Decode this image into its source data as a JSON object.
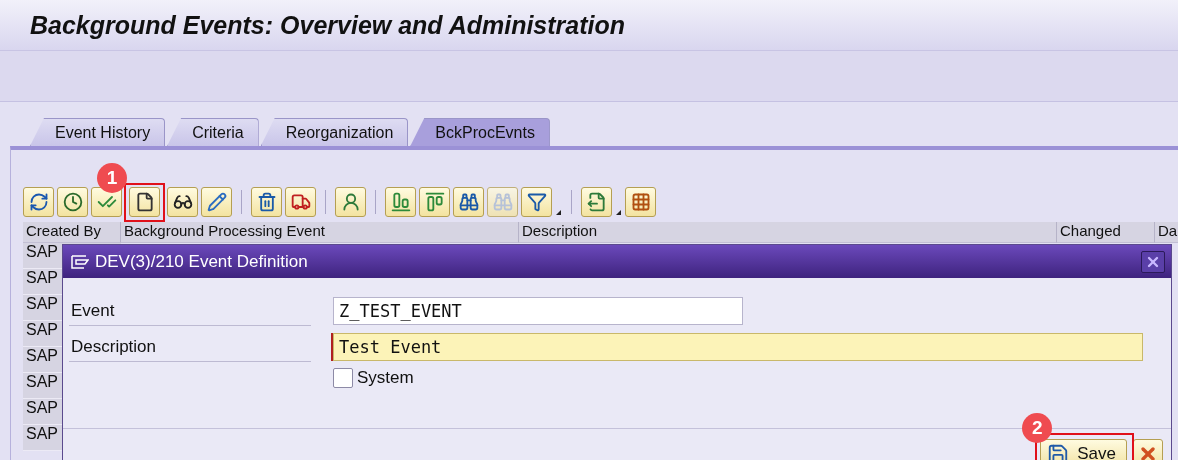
{
  "window": {
    "title": "Background Events: Overview and Administration"
  },
  "tabs": [
    {
      "label": "Event History",
      "selected": false
    },
    {
      "label": "Criteria",
      "selected": false
    },
    {
      "label": "Reorganization",
      "selected": false
    },
    {
      "label": "BckProcEvnts",
      "selected": true
    }
  ],
  "toolbar_groups": [
    [
      {
        "kind": "refresh",
        "disabled": false
      },
      {
        "kind": "clock",
        "disabled": false
      },
      {
        "kind": "checkedit",
        "disabled": false
      },
      {
        "kind": "create",
        "disabled": false,
        "callout": "1"
      },
      {
        "kind": "display",
        "disabled": false
      },
      {
        "kind": "edit",
        "disabled": false
      }
    ],
    [
      {
        "kind": "delete",
        "disabled": false
      },
      {
        "kind": "transport",
        "disabled": false
      }
    ],
    [
      {
        "kind": "user",
        "disabled": false
      }
    ],
    [
      {
        "kind": "sortasc",
        "disabled": false
      },
      {
        "kind": "sortdesc",
        "disabled": false
      },
      {
        "kind": "find",
        "disabled": false
      },
      {
        "kind": "findnext",
        "disabled": true
      },
      {
        "kind": "filter",
        "disabled": false,
        "dropdown": true
      }
    ],
    [
      {
        "kind": "export",
        "disabled": false,
        "dropdown": true
      },
      {
        "kind": "layout",
        "disabled": false
      }
    ]
  ],
  "table": {
    "columns": [
      "Created By",
      "Background Processing Event",
      "Description",
      "Changed",
      "Da"
    ],
    "rows": [
      [
        "SAP"
      ],
      [
        "SAP"
      ],
      [
        "SAP"
      ],
      [
        "SAP"
      ],
      [
        "SAP"
      ],
      [
        "SAP"
      ],
      [
        "SAP"
      ],
      [
        "SAP"
      ]
    ]
  },
  "dialog": {
    "title": "DEV(3)/210 Event Definition",
    "fields": [
      {
        "label": "Event",
        "value": "Z_TEST_EVENT",
        "required": false
      },
      {
        "label": "Description",
        "value": "Test Event",
        "required": true
      }
    ],
    "checkbox": {
      "label": "System",
      "checked": false
    },
    "buttons": [
      {
        "kind": "save",
        "label": "Save",
        "callout": "2"
      },
      {
        "kind": "cancel"
      }
    ]
  }
}
